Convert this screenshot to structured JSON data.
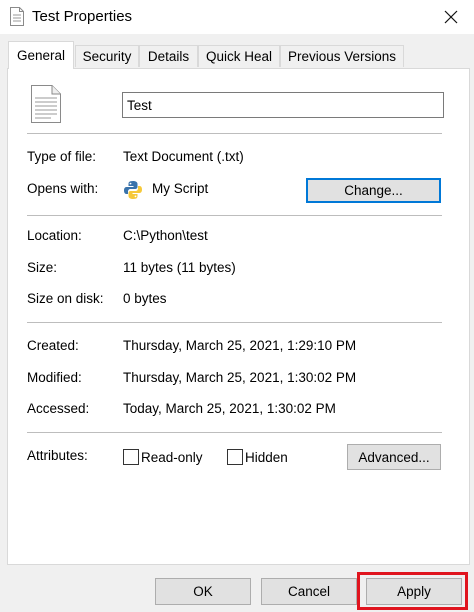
{
  "window": {
    "title": "Test Properties"
  },
  "tabs": [
    {
      "label": "General",
      "active": true
    },
    {
      "label": "Security"
    },
    {
      "label": "Details"
    },
    {
      "label": "Quick Heal"
    },
    {
      "label": "Previous Versions"
    }
  ],
  "file": {
    "name": "Test"
  },
  "type": {
    "label": "Type of file:",
    "value": "Text Document (.txt)"
  },
  "opens": {
    "label": "Opens with:",
    "value": "My Script",
    "change_label": "Change..."
  },
  "location": {
    "label": "Location:",
    "value": "C:\\Python\\test"
  },
  "size": {
    "label": "Size:",
    "value": "11 bytes (11 bytes)"
  },
  "size_disk": {
    "label": "Size on disk:",
    "value": "0 bytes"
  },
  "created": {
    "label": "Created:",
    "value": "Thursday, March 25, 2021, 1:29:10 PM"
  },
  "modified": {
    "label": "Modified:",
    "value": "Thursday, March 25, 2021, 1:30:02 PM"
  },
  "accessed": {
    "label": "Accessed:",
    "value": "Today, March 25, 2021, 1:30:02 PM"
  },
  "attributes": {
    "label": "Attributes:",
    "readonly_label": "Read-only",
    "hidden_label": "Hidden",
    "advanced_label": "Advanced..."
  },
  "footer": {
    "ok_label": "OK",
    "cancel_label": "Cancel",
    "apply_label": "Apply"
  },
  "colors": {
    "highlight": "#e0141e",
    "focus": "#0078d7"
  },
  "icons": {
    "title": "document-icon",
    "file": "text-document-icon",
    "program": "python-icon",
    "close": "close-icon"
  }
}
